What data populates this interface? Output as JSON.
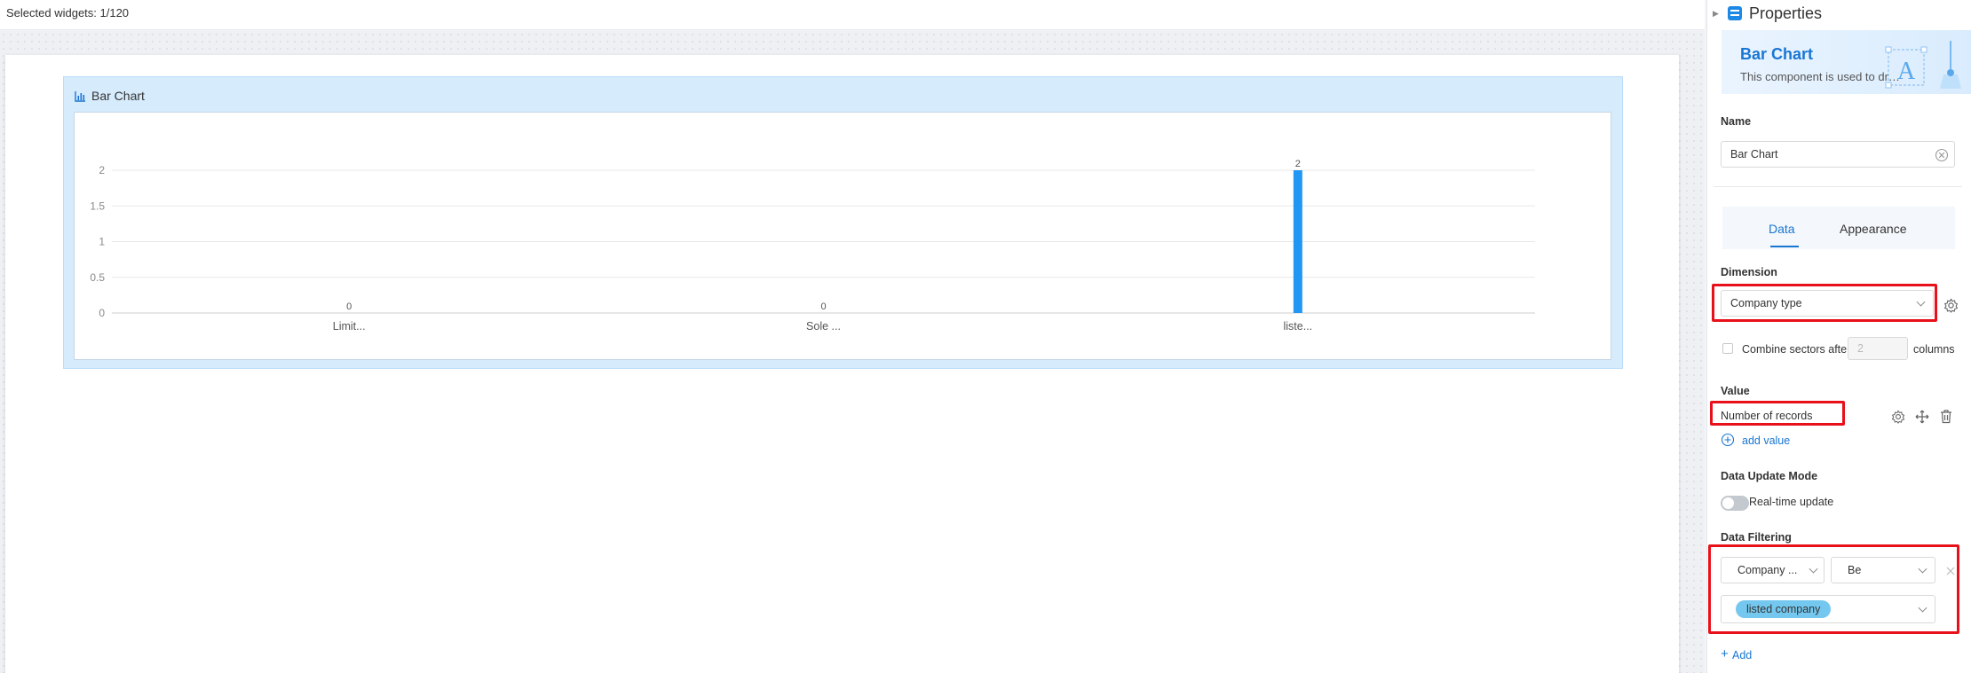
{
  "topbar": {
    "selected_widgets": "Selected widgets: 1/120"
  },
  "widget": {
    "title": "Bar Chart",
    "chart_data": {
      "type": "bar",
      "categories": [
        "Limit...",
        "Sole ...",
        "liste..."
      ],
      "values": [
        0,
        0,
        2
      ],
      "data_labels": [
        "0",
        "0",
        "2"
      ],
      "yticks": [
        "0",
        "0.5",
        "1",
        "1.5",
        "2"
      ],
      "ylim": [
        0,
        2
      ],
      "grid": true,
      "bar_color": "#2196f3"
    }
  },
  "panel": {
    "title": "Properties",
    "component_title": "Bar Chart",
    "component_desc": "This component is used to dra...",
    "name_label": "Name",
    "name_value": "Bar Chart",
    "tabs": [
      "Data",
      "Appearance"
    ],
    "dimension_label": "Dimension",
    "dimension_value": "Company type",
    "combine_label": "Combine sectors after",
    "combine_placeholder": "2",
    "combine_suffix": "columns",
    "value_label": "Value",
    "value_item": "Number of records",
    "add_value": "add value",
    "update_label": "Data Update Mode",
    "update_toggle": "Real-time update",
    "filter_label": "Data Filtering",
    "filter_field": "Company ...",
    "filter_op": "Be",
    "filter_tag": "listed company",
    "add_filter": "Add"
  },
  "colors": {
    "accent": "#1976d2",
    "highlight": "#e8101a",
    "tag": "#74c8ef"
  }
}
